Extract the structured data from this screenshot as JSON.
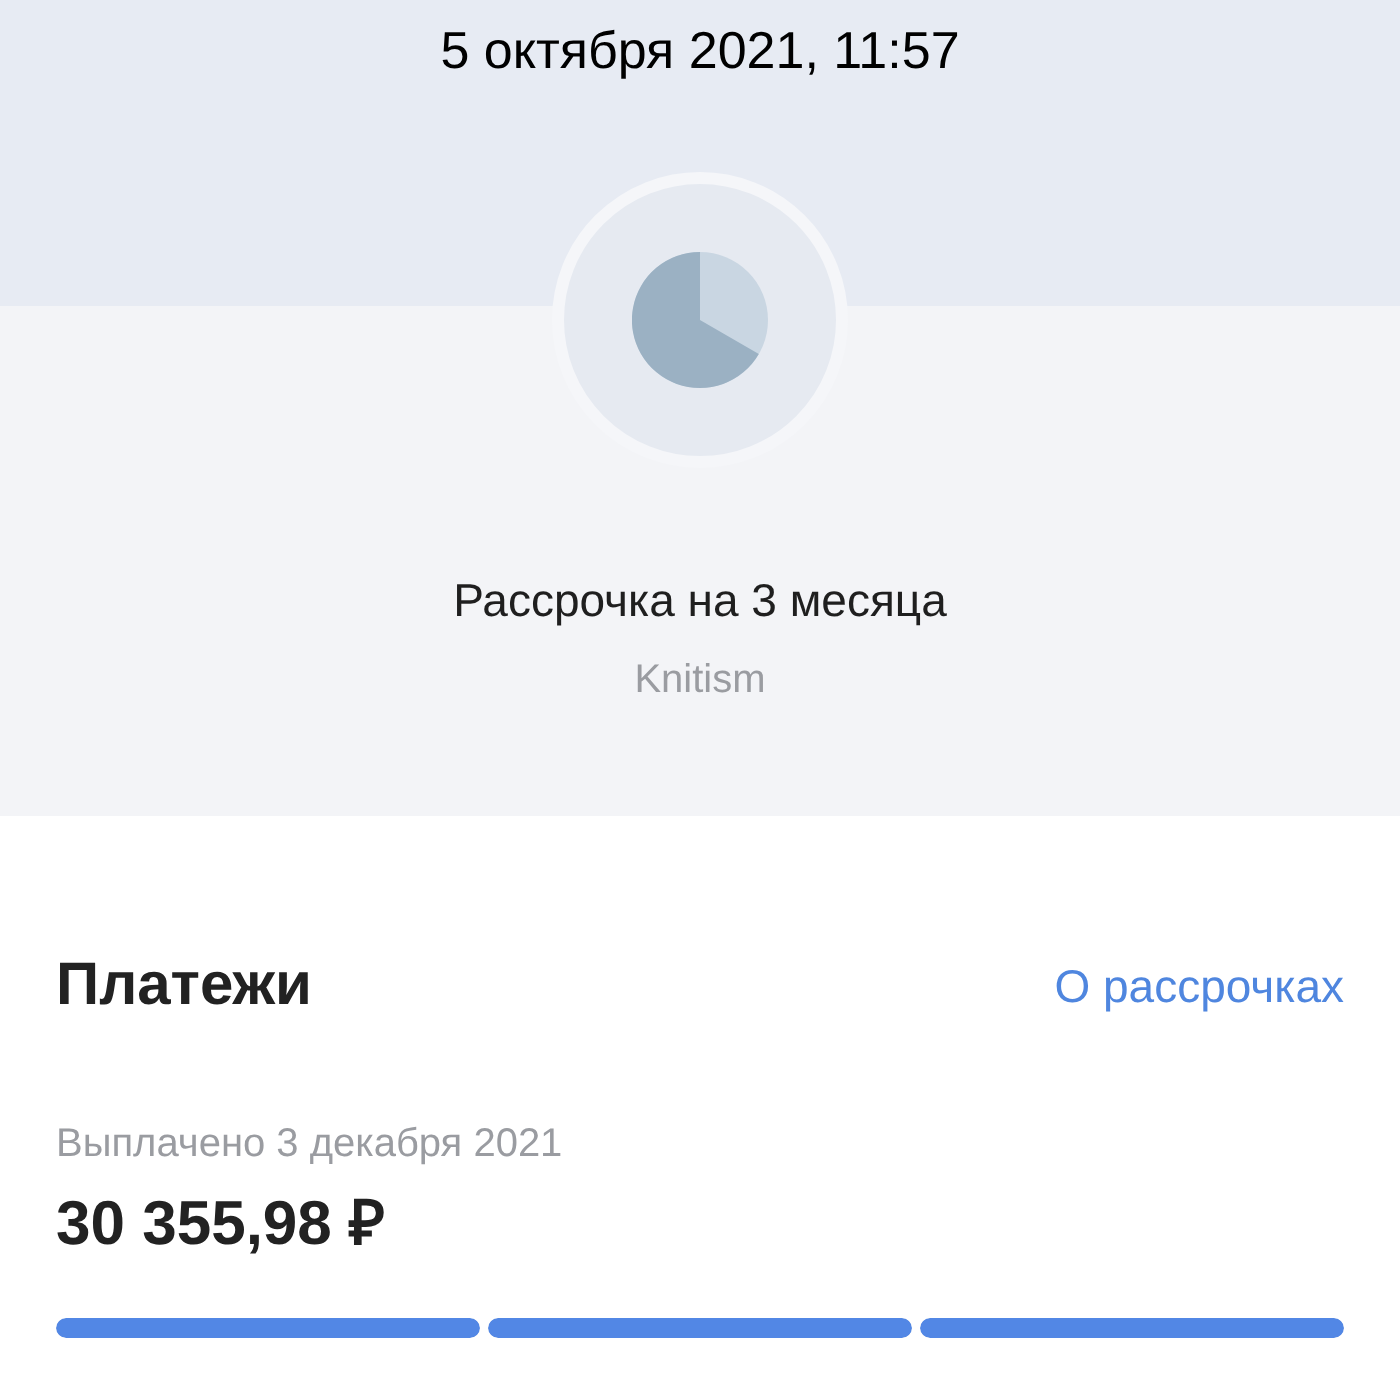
{
  "header": {
    "date": "5 октября 2021, 11:57"
  },
  "plan": {
    "title": "Рассрочка на 3 месяца",
    "merchant": "Knitism"
  },
  "payments": {
    "title": "Платежи",
    "link": "О рассрочках",
    "status": "Выплачено 3 декабря 2021",
    "amount": "30 355,98 ₽",
    "segments": [
      {
        "level": 1
      },
      {
        "level": 1
      },
      {
        "level": 1
      }
    ]
  }
}
